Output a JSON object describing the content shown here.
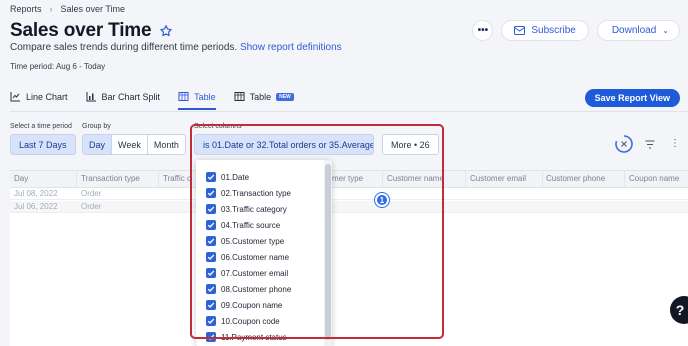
{
  "breadcrumb": {
    "parent": "Reports",
    "current": "Sales over Time"
  },
  "header": {
    "title": "Sales over Time",
    "subtitle": "Compare sales trends during different time periods.",
    "definitions_link": "Show report definitions",
    "time_period": "Time period: Aug 6 - Today",
    "more_icon": "ellipsis-icon",
    "subscribe_label": "Subscribe",
    "download_label": "Download"
  },
  "tabs": [
    {
      "label": "Line Chart",
      "icon": "line-chart-icon",
      "active": false
    },
    {
      "label": "Bar Chart Split",
      "icon": "bar-chart-icon",
      "active": false
    },
    {
      "label": "Table",
      "icon": "table-icon",
      "active": true
    },
    {
      "label": "Table",
      "icon": "table-icon",
      "active": false,
      "badge": "NEW"
    }
  ],
  "save_view_label": "Save Report View",
  "filters": {
    "time_label": "Select a time period",
    "time_value": "Last 7 Days",
    "groupby_label": "Group by",
    "groupby_options": [
      "Day",
      "Week",
      "Month"
    ],
    "groupby_selected": "Day",
    "columns_label": "Select columns",
    "columns_value": "is 01.Date or 32.Total orders or 35.Average...",
    "more_label": "More • 26"
  },
  "table": {
    "headers": [
      "Day",
      "Transaction type",
      "Traffic c",
      "mer type",
      "Customer name",
      "Customer email",
      "Customer phone",
      "Coupon name"
    ],
    "rows": [
      [
        "Jul 08, 2022",
        "Order"
      ],
      [
        "Jul 06, 2022",
        "Order"
      ]
    ]
  },
  "column_options": [
    "01.Date",
    "02.Transaction type",
    "03.Traffic category",
    "04.Traffic source",
    "05.Customer type",
    "06.Customer name",
    "07.Customer email",
    "08.Customer phone",
    "09.Coupon name",
    "10.Coupon code",
    "11.Payment status"
  ],
  "step_marker": "1",
  "help_label": "?",
  "colors": {
    "accent": "#2d5bd6",
    "primary_button": "#1d5bd8",
    "highlight_border": "#c02c37",
    "checkbox": "#2f63d8"
  }
}
